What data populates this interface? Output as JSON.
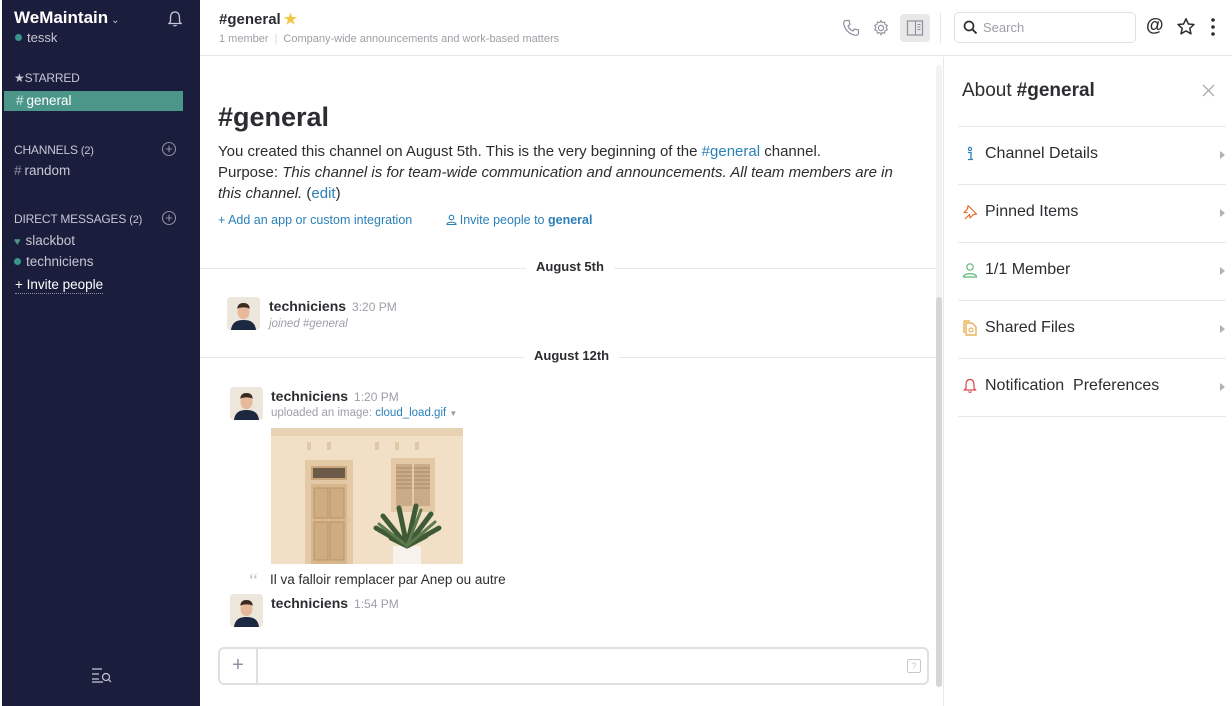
{
  "sidebar": {
    "team_name": "WeMaintain",
    "user": "tessk",
    "starred_label": "STARRED",
    "starred_channel": "general",
    "channels_label": "CHANNELS",
    "channels_count": "(2)",
    "channels": [
      "random"
    ],
    "dm_label": "DIRECT MESSAGES",
    "dm_count": "(2)",
    "dms": [
      "slackbot",
      "techniciens"
    ],
    "invite": "+ Invite people"
  },
  "header": {
    "channel": "#general",
    "members": "1 member",
    "topic": "Company-wide announcements and work-based matters",
    "search_placeholder": "Search",
    "at": "@"
  },
  "intro": {
    "title": "#general",
    "line1_a": "You created this channel on August 5th. This is the very beginning of the ",
    "line1_link": "#general",
    "line1_b": " channel.",
    "purpose_label": "Purpose: ",
    "purpose_text": "This channel is for team-wide communication and announcements. All team members are in this channel.",
    "edit_open": " (",
    "edit": "edit",
    "edit_close": ")",
    "add_app": "+ Add an app or custom integration",
    "invite_prefix": "Invite people to ",
    "invite_channel": "general"
  },
  "messages": {
    "day1": "August 5th",
    "day2": "August 12th",
    "m1": {
      "author": "techniciens",
      "time": "3:20 PM",
      "text": "joined #general"
    },
    "m2": {
      "author": "techniciens",
      "time": "1:20 PM",
      "uploaded": "uploaded an image: ",
      "file": "cloud_load.gif",
      "comment": "Il va falloir remplacer par Anep ou autre"
    },
    "m3": {
      "author": "techniciens",
      "time": "1:54 PM"
    }
  },
  "composer": {
    "plus": "+",
    "help": "?"
  },
  "right_panel": {
    "title_prefix": "About",
    "title_channel": "#general",
    "items": [
      {
        "label": "Channel Details",
        "icon": "info-icon"
      },
      {
        "label": "Pinned Items",
        "icon": "pin-icon"
      },
      {
        "label": "1/1 Member",
        "icon": "member-icon"
      },
      {
        "label": "Shared Files",
        "icon": "files-icon"
      },
      {
        "label": "Notification  Preferences",
        "icon": "bell-icon"
      }
    ]
  },
  "colors": {
    "sidebar_bg": "#1b1d3c",
    "active_channel": "#4c9689",
    "link": "#2a80b9",
    "star": "#f2c744"
  }
}
